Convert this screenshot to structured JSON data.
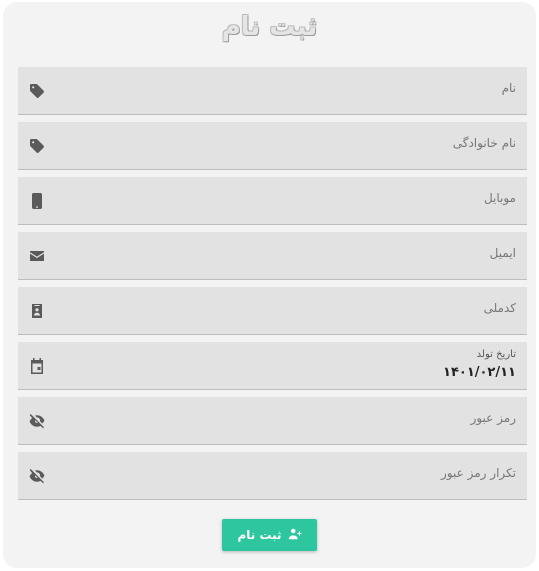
{
  "form": {
    "title": "ثبت نام",
    "fields": [
      {
        "label": "نام",
        "icon": "tag-icon"
      },
      {
        "label": "نام خانوادگی",
        "icon": "tag-icon"
      },
      {
        "label": "موبایل",
        "icon": "mobile-phone-icon"
      },
      {
        "label": "ایمیل",
        "icon": "envelope-icon"
      },
      {
        "label": "کدملی",
        "icon": "id-badge-icon"
      },
      {
        "label": "تاریخ تولد",
        "value": "۱۴۰۱/۰۲/۱۱",
        "icon": "calendar-icon"
      },
      {
        "label": "رمز عبور",
        "icon": "eye-slash-icon"
      },
      {
        "label": "تکرار رمز عبور",
        "icon": "eye-slash-icon"
      }
    ],
    "submit": {
      "label": "ثبت نام",
      "icon": "user-plus-icon"
    }
  },
  "colors": {
    "card_background": "#f3f3f3",
    "field_background": "#e2e2e2",
    "accent": "#2ec69f"
  }
}
